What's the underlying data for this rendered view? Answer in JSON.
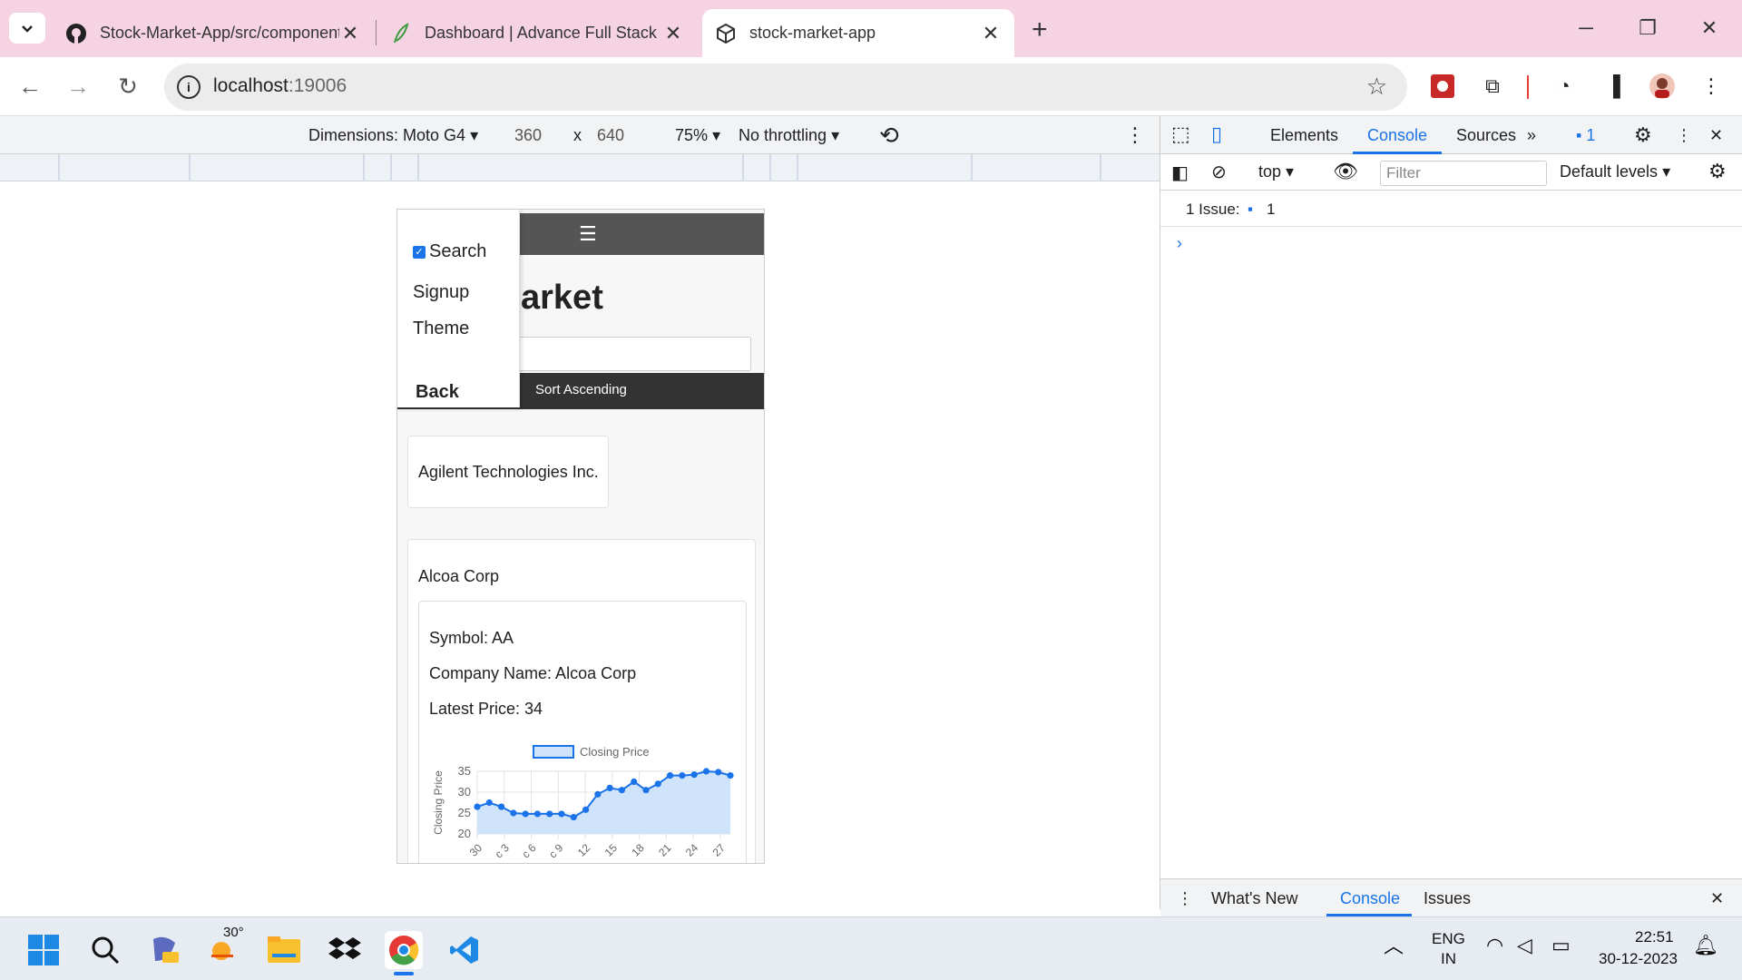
{
  "tabs": [
    {
      "title": "Stock-Market-App/src/components",
      "icon": "github-icon"
    },
    {
      "title": "Dashboard | Advance Full Stack",
      "icon": "feather-icon"
    },
    {
      "title": "stock-market-app",
      "icon": "cube-icon"
    }
  ],
  "address_bar": {
    "url_host": "localhost",
    "url_port": ":19006"
  },
  "device_toolbar": {
    "dimensions": "Dimensions: Moto G4",
    "width": "360",
    "times": "x",
    "height": "640",
    "zoom": "75%",
    "throttling": "No throttling"
  },
  "app": {
    "nav_menu_icon": "☰",
    "title_visible": "arket",
    "sort_label": "Sort Ascending",
    "drawer": {
      "search_label": "Search",
      "signup_label": "Signup",
      "theme_label": "Theme",
      "back_label": "Back"
    },
    "cards": [
      {
        "company": "Agilent Technologies Inc."
      },
      {
        "company": "Alcoa Corp",
        "symbol_line": "Symbol: AA",
        "company_line": "Company Name: Alcoa Corp",
        "price_line": "Latest Price: 34"
      }
    ]
  },
  "chart_data": {
    "type": "line",
    "title": "",
    "legend": "Closing Price",
    "ylabel": "Closing Price",
    "xlabel": "",
    "ylim": [
      20,
      35
    ],
    "yticks": [
      "35",
      "30",
      "25",
      "20"
    ],
    "xtick_labels": [
      "30",
      "c 3",
      "c 6",
      "c 9",
      "12",
      "15",
      "18",
      "21",
      "24",
      "27"
    ],
    "series": [
      {
        "name": "Closing Price",
        "values": [
          26.5,
          27.5,
          26.5,
          25,
          24.8,
          24.8,
          24.8,
          24.8,
          24,
          25.8,
          29.5,
          31,
          30.5,
          32.5,
          30.5,
          32,
          34,
          34,
          34.2,
          35,
          34.8,
          34
        ]
      }
    ],
    "fill_color": "#cfe3fb",
    "line_color": "#1a73e8"
  },
  "devtools": {
    "tabs": [
      "Elements",
      "Console",
      "Sources"
    ],
    "active_tab": "Console",
    "issues_badge": "1",
    "context": "top",
    "filter_placeholder": "Filter",
    "levels": "Default levels",
    "issues_label": "1 Issue:",
    "issues_count": "1",
    "prompt": "›",
    "drawer_tabs": [
      "What's New",
      "Console",
      "Issues"
    ]
  },
  "taskbar": {
    "weather": "30°",
    "lang_top": "ENG",
    "lang_bottom": "IN",
    "time": "22:51",
    "date": "30-12-2023"
  }
}
